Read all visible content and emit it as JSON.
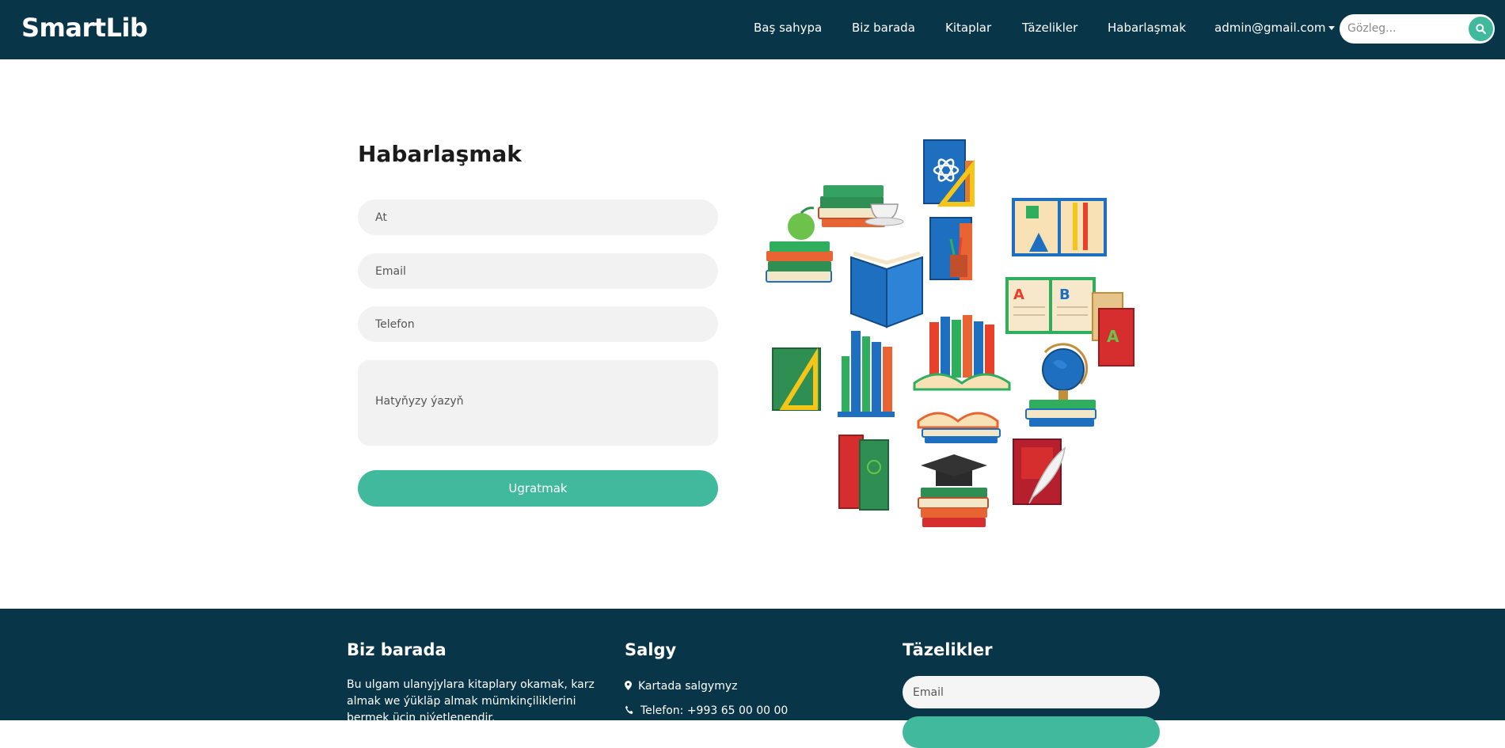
{
  "brand": "SmartLib",
  "nav": {
    "items": [
      "Baş sahypa",
      "Biz barada",
      "Kitaplar",
      "Täzelikler",
      "Habarlaşmak"
    ],
    "user": "admin@gmail.com",
    "search_placeholder": "Gözleg..."
  },
  "contact": {
    "title": "Habarlaşmak",
    "name_placeholder": "At",
    "email_placeholder": "Email",
    "phone_placeholder": "Telefon",
    "message_placeholder": "Hatyňyzy ýazyň",
    "submit_label": "Ugratmak"
  },
  "footer": {
    "about_title": "Biz barada",
    "about_text": "Bu ulgam ulanyjylara kitaplary okamak, karz almak we ýükläp almak mümkinçiliklerini bermek üçin niýetlenendir.",
    "address_title": "Salgy",
    "address_line": "Kartada salgymyz",
    "phone_line": "Telefon: +993 65 00 00 00",
    "news_title": "Täzelikler",
    "news_email_placeholder": "Email"
  },
  "colors": {
    "navbar": "#093549",
    "accent": "#41b99d",
    "field": "#f2f2f2"
  }
}
